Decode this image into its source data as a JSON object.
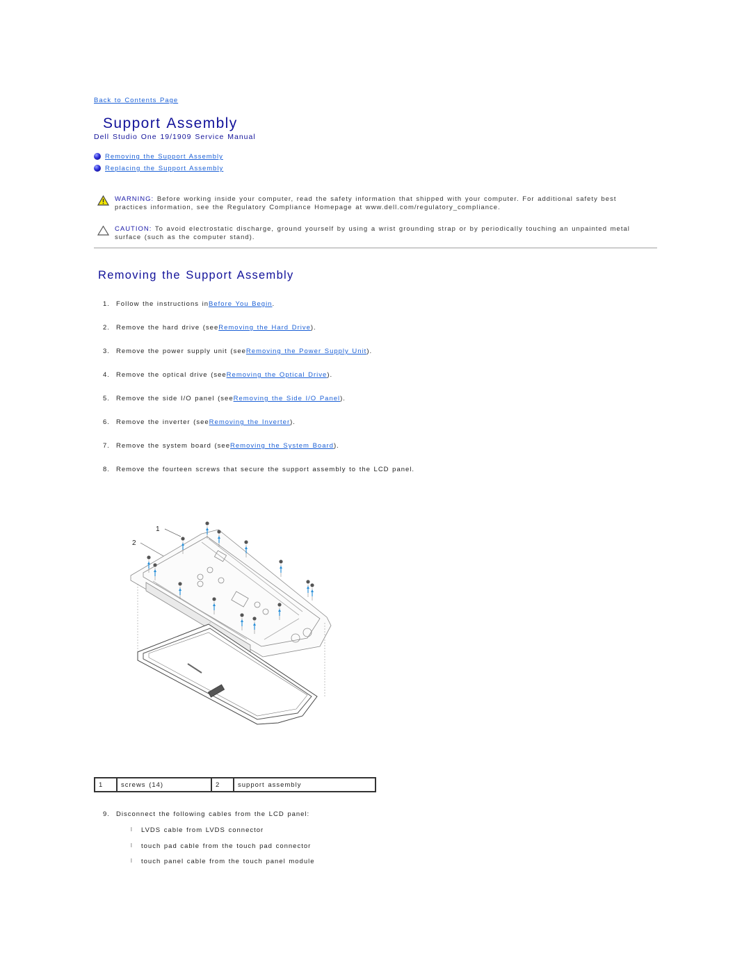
{
  "nav": {
    "back_link": "Back to Contents Page"
  },
  "header": {
    "title": "Support Assembly",
    "subtitle": "Dell Studio One 19/1909 Service Manual"
  },
  "toc": [
    {
      "label": "Removing the Support Assembly",
      "icon": "blue-bullet-icon"
    },
    {
      "label": "Replacing the Support Assembly",
      "icon": "blue-bullet-icon"
    }
  ],
  "notices": {
    "warning": {
      "icon": "warning-triangle-icon",
      "label": "WARNING:",
      "text": " Before working inside your computer, read the safety information that shipped with your computer. For additional safety best practices information, see the Regulatory Compliance Homepage at www.dell.com/regulatory_compliance."
    },
    "caution": {
      "icon": "caution-triangle-icon",
      "label": "CAUTION:",
      "text": " To avoid electrostatic discharge, ground yourself by using a wrist grounding strap or by periodically touching an unpainted metal surface (such as the computer stand)."
    }
  },
  "section": {
    "heading": "Removing the Support Assembly",
    "steps": [
      {
        "num": "1.",
        "pre": "Follow the instructions in ",
        "link": "Before You Begin",
        "post": "."
      },
      {
        "num": "2.",
        "pre": "Remove the hard drive (see ",
        "link": "Removing the Hard Drive",
        "post": ")."
      },
      {
        "num": "3.",
        "pre": "Remove the power supply unit (see ",
        "link": "Removing the Power Supply Unit",
        "post": ")."
      },
      {
        "num": "4.",
        "pre": "Remove the optical drive (see ",
        "link": "Removing the Optical Drive",
        "post": ")."
      },
      {
        "num": "5.",
        "pre": "Remove the side I/O panel (see ",
        "link": "Removing the Side I/O Panel",
        "post": ")."
      },
      {
        "num": "6.",
        "pre": "Remove the inverter (see ",
        "link": "Removing the Inverter",
        "post": ")."
      },
      {
        "num": "7.",
        "pre": "Remove the system board (see ",
        "link": "Removing the System Board",
        "post": ")."
      },
      {
        "num": "8.",
        "pre": "Remove the fourteen screws that secure the support assembly to the LCD panel.",
        "link": "",
        "post": ""
      }
    ],
    "figure": {
      "callouts": [
        "1",
        "2"
      ]
    },
    "legend": [
      {
        "num": "1",
        "label": "screws (14)"
      },
      {
        "num": "2",
        "label": "support assembly"
      }
    ],
    "step9": {
      "num": "9.",
      "text": "Disconnect the following cables from the LCD panel:",
      "items": [
        "LVDS cable from LVDS connector",
        "touch pad cable from the touch pad connector",
        "touch panel cable from the touch panel module"
      ],
      "bullet": "l"
    }
  },
  "colors": {
    "heading": "#12129a",
    "link": "#1a5fd6",
    "screw_arrow": "#2a8fd8"
  }
}
